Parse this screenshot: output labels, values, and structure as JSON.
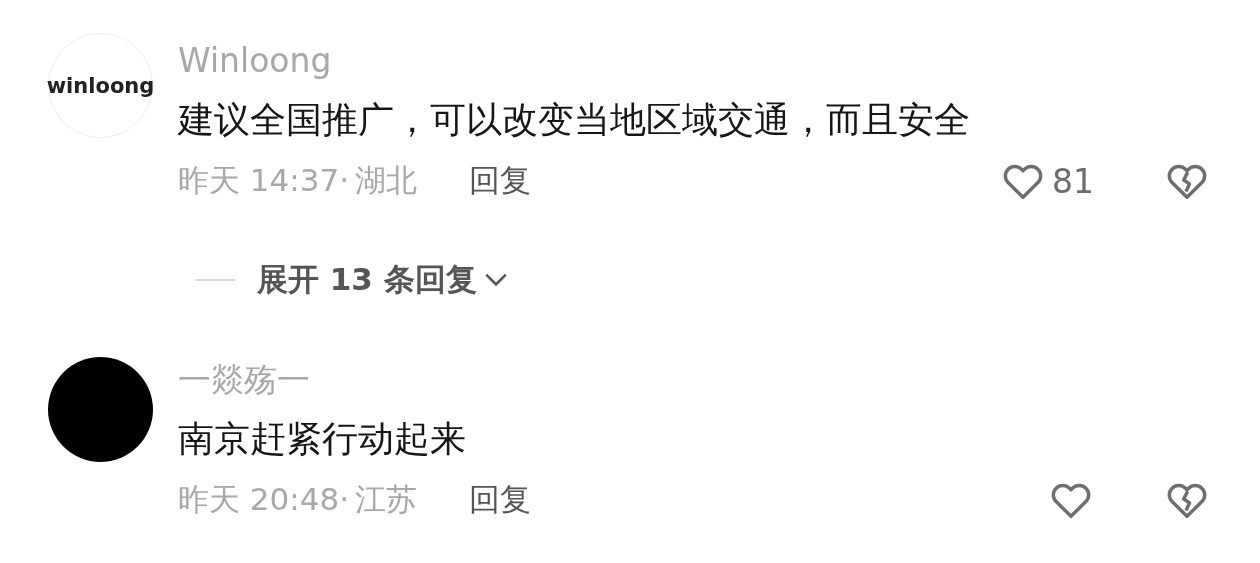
{
  "comments": [
    {
      "avatar": {
        "kind": "logo",
        "text": "winloong"
      },
      "username": "Winloong",
      "content": "建议全国推广，可以改变当地区域交通，而且安全",
      "time": "昨天 14:37·",
      "location": "湖北",
      "reply": "回复",
      "like_count": "81",
      "replies": {
        "label": "展开 13 条回复"
      }
    },
    {
      "avatar": {
        "kind": "plain"
      },
      "username": "一燚殇一",
      "content": "南京赶紧行动起来",
      "time": "昨天 20:48·",
      "location": "江苏",
      "reply": "回复"
    }
  ]
}
